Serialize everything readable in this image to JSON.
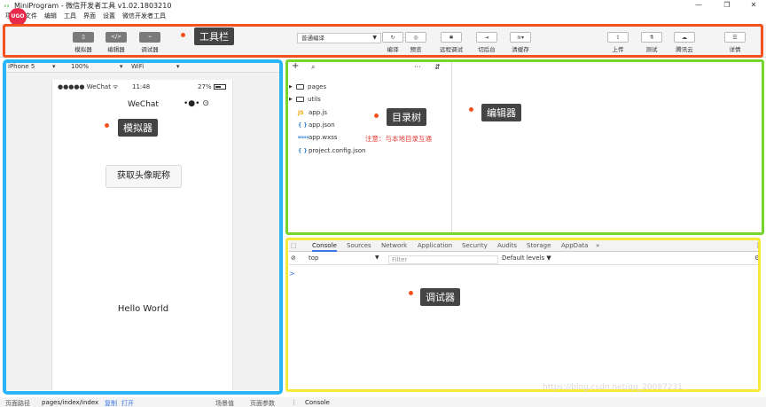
{
  "window": {
    "title": "MiniProgram - 微信开发者工具 v1.02.1803210",
    "min": "—",
    "max": "❐",
    "close": "✕"
  },
  "menu": [
    "项目",
    "文件",
    "编辑",
    "工具",
    "界面",
    "设置",
    "微信开发者工具"
  ],
  "toolbar": {
    "logo": "UGO",
    "buttons": [
      {
        "label": "模拟器",
        "icon": "phone-icon",
        "glyph": "▯"
      },
      {
        "label": "编辑器",
        "icon": "code-icon",
        "glyph": "</>"
      },
      {
        "label": "调试器",
        "icon": "debug-icon",
        "glyph": "⌁"
      }
    ],
    "compile_mode": "普通编译",
    "actions": [
      {
        "label": "编译",
        "icon": "refresh-icon",
        "glyph": "↻"
      },
      {
        "label": "预览",
        "icon": "eye-icon",
        "glyph": "◎"
      },
      {
        "label": "远程调试",
        "icon": "bug-icon",
        "glyph": "✱"
      },
      {
        "label": "切后台",
        "icon": "switch-icon",
        "glyph": "⇥"
      },
      {
        "label": "清缓存",
        "icon": "layers-icon",
        "glyph": "≋▾"
      }
    ],
    "right_actions": [
      {
        "label": "上传",
        "icon": "upload-icon",
        "glyph": "⇪"
      },
      {
        "label": "测试",
        "icon": "test-icon",
        "glyph": "⚗"
      },
      {
        "label": "腾讯云",
        "icon": "cloud-icon",
        "glyph": "☁"
      },
      {
        "label": "详情",
        "icon": "menu-icon",
        "glyph": "☰"
      }
    ]
  },
  "annotations": {
    "toolbar": "工具栏",
    "simulator": "模拟器",
    "directory": "目录树",
    "editor": "编辑器",
    "debugger": "调试器",
    "note": "注意：与本地目录互通"
  },
  "simulator": {
    "device": "iPhone 5",
    "zoom": "100%",
    "network": "WiFi",
    "carrier": "●●●●● WeChat",
    "time": "11:48",
    "battery": "27%",
    "nav_title": "WeChat",
    "capsule": "•●•  ⊙",
    "button": "获取头像昵称",
    "hello": "Hello World"
  },
  "tree": [
    {
      "name": "pages",
      "type": "folder"
    },
    {
      "name": "utils",
      "type": "folder"
    },
    {
      "name": "app.js",
      "type": "js",
      "badge": "JS"
    },
    {
      "name": "app.json",
      "type": "json",
      "badge": "{ }"
    },
    {
      "name": "app.wxss",
      "type": "wxss",
      "badge": "wxss"
    },
    {
      "name": "project.config.json",
      "type": "json",
      "badge": "{ }"
    }
  ],
  "dir_toolbar": {
    "add": "+",
    "search": "⌕",
    "more": "···",
    "split": "⇵"
  },
  "debugger": {
    "tabs": [
      "Console",
      "Sources",
      "Network",
      "Application",
      "Security",
      "Audits",
      "Storage",
      "AppData"
    ],
    "more": "»",
    "context": "top",
    "filter_placeholder": "Filter",
    "levels": "Default levels ▼",
    "prompt": ">"
  },
  "bottom": {
    "path_label": "页面路径",
    "path": "pages/index/index",
    "copy": "复制",
    "open": "打开",
    "scene": "场景值",
    "params": "页面参数",
    "console_tab": "Console"
  },
  "watermark": "https://blog.csdn.net/qq_20087231"
}
